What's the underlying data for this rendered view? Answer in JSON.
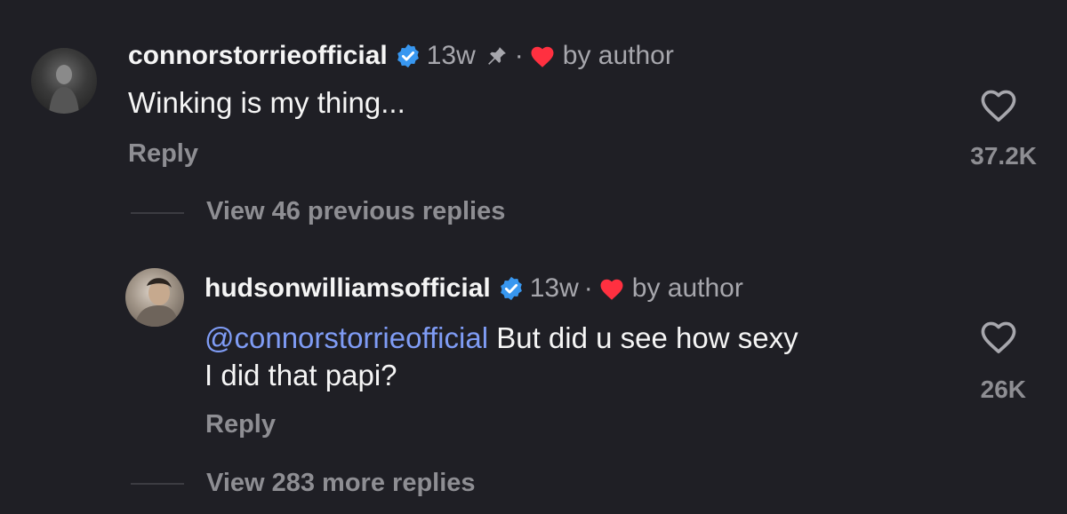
{
  "comment": {
    "username": "connorstorrieofficial",
    "age": "13w",
    "separator": "·",
    "liked_label": "by author",
    "text": "Winking is my thing...",
    "reply_label": "Reply",
    "like_count": "37.2K",
    "view_replies_label": "View 46 previous replies"
  },
  "reply": {
    "username": "hudsonwilliamsofficial",
    "age": "13w",
    "separator": "·",
    "liked_label": "by author",
    "mention": "@connorstorrieofficial",
    "text_line1": "But did u see how sexy",
    "text_line2": "I did that papi?",
    "reply_label": "Reply",
    "like_count": "26K",
    "view_more_label": "View 283 more replies"
  },
  "colors": {
    "background": "#1f1f25",
    "mention": "#7f9cf5",
    "verified": "#3897f0",
    "heart": "#ff3040"
  }
}
